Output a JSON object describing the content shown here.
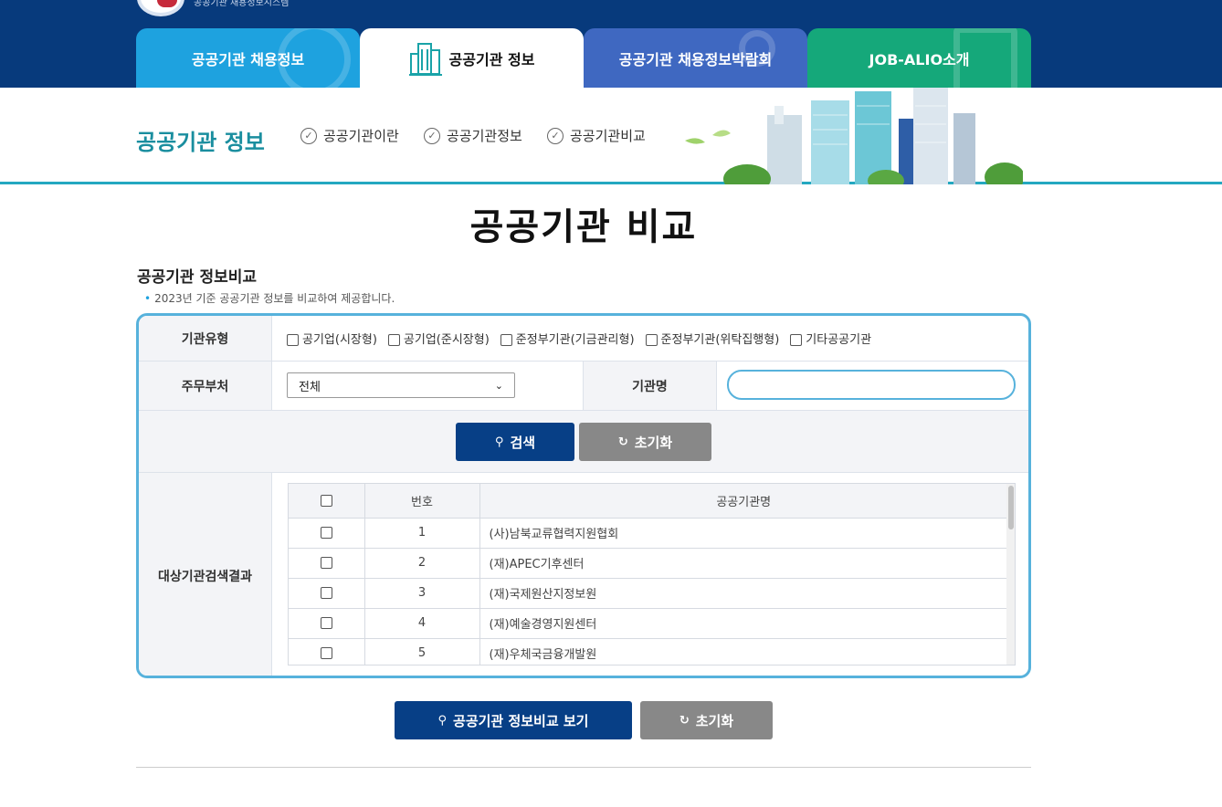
{
  "header": {
    "logo_text": "공공기관 채용정보시스템",
    "tabs": [
      {
        "label": "공공기관 채용정보"
      },
      {
        "label": "공공기관 정보"
      },
      {
        "label": "공공기관 채용정보박람회"
      },
      {
        "label": "JOB-ALIO소개"
      }
    ],
    "active_tab": "공공기관 정보"
  },
  "subheader": {
    "title": "공공기관 정보",
    "menu": [
      "공공기관이란",
      "공공기관정보",
      "공공기관비교"
    ]
  },
  "page": {
    "title": "공공기관 비교",
    "section_title": "공공기관 정보비교",
    "section_desc": "2023년 기준 공공기관 정보를 비교하여 제공합니다."
  },
  "form": {
    "type_label": "기관유형",
    "types": [
      "공기업(시장형)",
      "공기업(준시장형)",
      "준정부기관(기금관리형)",
      "준정부기관(위탁집행형)",
      "기타공공기관"
    ],
    "ministry_label": "주무부처",
    "ministry_value": "전체",
    "name_label": "기관명",
    "name_value": "",
    "search_button": "검색",
    "reset_button": "초기화"
  },
  "results": {
    "label": "대상기관검색결과",
    "col_no": "번호",
    "col_name": "공공기관명",
    "rows": [
      {
        "no": "1",
        "name": "(사)남북교류협력지원협회"
      },
      {
        "no": "2",
        "name": "(재)APEC기후센터"
      },
      {
        "no": "3",
        "name": "(재)국제원산지정보원"
      },
      {
        "no": "4",
        "name": "(재)예술경영지원센터"
      },
      {
        "no": "5",
        "name": "(재)우체국금융개발원"
      }
    ]
  },
  "footer_buttons": {
    "compare": "공공기관 정보비교 보기",
    "reset": "초기화"
  },
  "colors": {
    "header_bg": "#073a7c",
    "tab1": "#1ea2df",
    "tab3": "#3f68c1",
    "tab4": "#15a87a",
    "accent": "#1a8e9f",
    "primary_button": "#073f86"
  }
}
